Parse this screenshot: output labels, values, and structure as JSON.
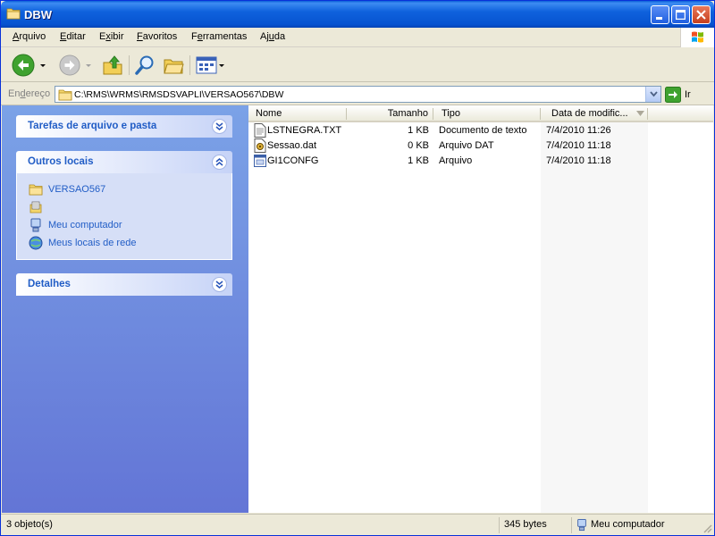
{
  "window": {
    "title": "DBW",
    "icons": {
      "title": "folder-icon",
      "minimize": "minimize-icon",
      "maximize": "maximize-icon",
      "close": "close-icon"
    }
  },
  "menu": {
    "items": [
      {
        "pre": "",
        "key": "A",
        "post": "rquivo"
      },
      {
        "pre": "",
        "key": "E",
        "post": "ditar"
      },
      {
        "pre": "E",
        "key": "x",
        "post": "ibir"
      },
      {
        "pre": "",
        "key": "F",
        "post": "avoritos"
      },
      {
        "pre": "F",
        "key": "e",
        "post": "rramentas"
      },
      {
        "pre": "Aj",
        "key": "u",
        "post": "da"
      }
    ]
  },
  "toolbar": {
    "icons": [
      "back-arrow-icon",
      "forward-arrow-icon",
      "up-folder-icon",
      "search-icon",
      "folders-icon",
      "views-icon"
    ]
  },
  "address": {
    "label_pre": "En",
    "label_key": "d",
    "label_post": "ereço",
    "path": "C:\\RMS\\WRMS\\RMSDSVAPLI\\VERSAO567\\DBW",
    "go_label": "Ir"
  },
  "taskpane": {
    "file_tasks": {
      "title": "Tarefas de arquivo e pasta"
    },
    "other_places": {
      "title": "Outros locais",
      "items": [
        {
          "label": "VERSAO567",
          "icon": "folder-icon"
        },
        {
          "label": "",
          "icon": "shared-documents-icon"
        },
        {
          "label": "Meu computador",
          "icon": "computer-icon"
        },
        {
          "label": "Meus locais de rede",
          "icon": "network-icon"
        }
      ]
    },
    "details": {
      "title": "Detalhes"
    }
  },
  "files": {
    "columns": [
      "Nome",
      "Tamanho",
      "Tipo",
      "Data de modific..."
    ],
    "rows": [
      {
        "name": "LSTNEGRA.TXT",
        "size": "1 KB",
        "type": "Documento de texto",
        "date": "7/4/2010 11:26",
        "icon": "text-file-icon"
      },
      {
        "name": "Sessao.dat",
        "size": "0 KB",
        "type": "Arquivo DAT",
        "date": "7/4/2010 11:18",
        "icon": "dat-file-icon"
      },
      {
        "name": "GI1CONFG",
        "size": "1 KB",
        "type": "Arquivo",
        "date": "7/4/2010 11:18",
        "icon": "generic-file-icon"
      }
    ]
  },
  "status": {
    "objects": "3 objeto(s)",
    "size": "345 bytes",
    "location": "Meu computador"
  },
  "colors": {
    "titlebar": "#0753d0",
    "taskpane": "#6375d6",
    "link": "#215dc6"
  }
}
